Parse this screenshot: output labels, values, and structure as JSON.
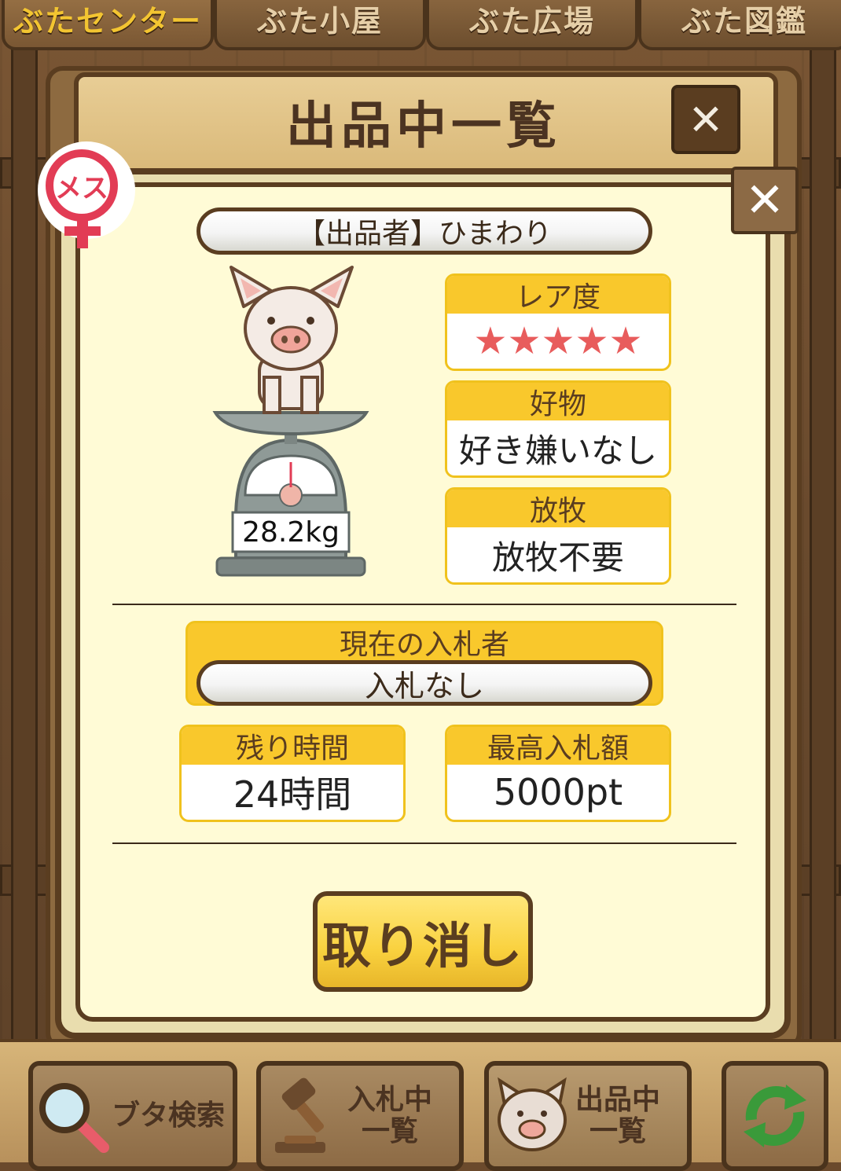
{
  "top_tabs": [
    "ぶたセンター",
    "ぶた小屋",
    "ぶた広場",
    "ぶた図鑑"
  ],
  "window_title": "出品中一覧",
  "close_symbol": "✕",
  "gender": {
    "label": "メス",
    "color": "#e23c55"
  },
  "seller": "【出品者】ひまわり",
  "pig": {
    "weight": "28.2kg"
  },
  "rarity": {
    "label": "レア度",
    "stars": 5,
    "star_glyph": "★★★★★"
  },
  "favorite": {
    "label": "好物",
    "value": "好き嫌いなし"
  },
  "grazing": {
    "label": "放牧",
    "value": "放牧不要"
  },
  "current_bidder": {
    "label": "現在の入札者",
    "value": "入札なし"
  },
  "remaining_time": {
    "label": "残り時間",
    "value": "24時間"
  },
  "max_bid": {
    "label": "最高入札額",
    "value": "5000pt"
  },
  "cancel_button": "取り消し",
  "bottom_nav": {
    "search": "ブタ検索",
    "bidding_line1": "入札中",
    "bidding_line2": "一覧",
    "listing_line1": "出品中",
    "listing_line2": "一覧"
  },
  "colors": {
    "accent": "#f9c82c",
    "brown": "#5a3d20",
    "cream": "#fffbd6",
    "star": "#e85c5c"
  }
}
